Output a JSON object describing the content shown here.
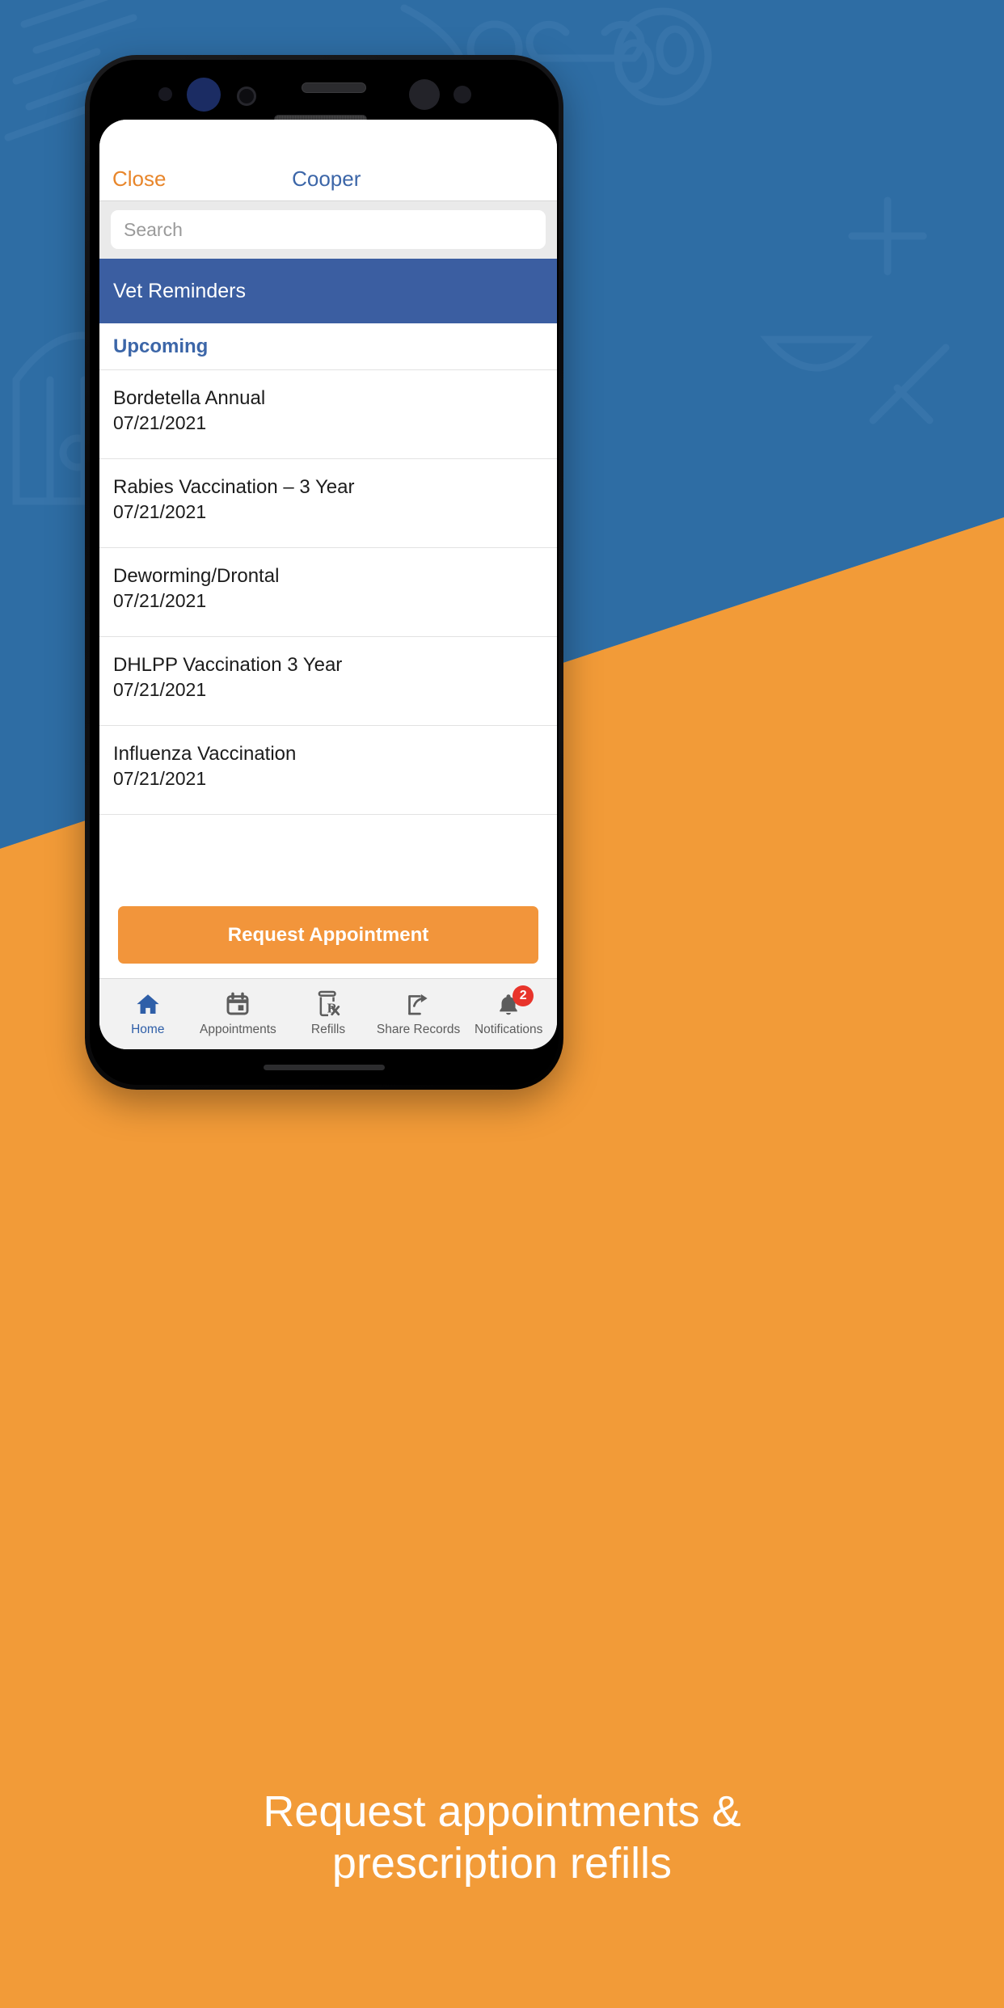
{
  "phone": {
    "app": {
      "nav": {
        "close_label": "Close",
        "title": "Cooper"
      },
      "search": {
        "placeholder": "Search",
        "value": ""
      },
      "section": {
        "title": "Vet Reminders"
      },
      "subsection": {
        "title": "Upcoming"
      },
      "reminders": [
        {
          "title": "Bordetella Annual",
          "date": "07/21/2021"
        },
        {
          "title": "Rabies Vaccination – 3 Year",
          "date": "07/21/2021"
        },
        {
          "title": "Deworming/Drontal",
          "date": "07/21/2021"
        },
        {
          "title": "DHLPP Vaccination 3 Year",
          "date": "07/21/2021"
        },
        {
          "title": "Influenza Vaccination",
          "date": "07/21/2021"
        }
      ],
      "cta": {
        "label": "Request Appointment"
      },
      "tabs": [
        {
          "label": "Home",
          "icon": "home-icon",
          "active": true,
          "badge": ""
        },
        {
          "label": "Appointments",
          "icon": "calendar-icon",
          "active": false,
          "badge": ""
        },
        {
          "label": "Refills",
          "icon": "pill-bottle-rx-icon",
          "active": false,
          "badge": ""
        },
        {
          "label": "Share Records",
          "icon": "share-arrow-icon",
          "active": false,
          "badge": ""
        },
        {
          "label": "Notifications",
          "icon": "bell-icon",
          "active": false,
          "badge": "2"
        }
      ]
    }
  },
  "caption": {
    "line1": "Request appointments &",
    "line2": "prescription refills"
  },
  "colors": {
    "brand_orange": "#F2953B",
    "brand_blue": "#3B5EA1",
    "link_blue": "#3C66A8",
    "close_orange": "#E8862B",
    "badge_red": "#E8342B",
    "bg_blue": "#2E6DA4",
    "bg_orange": "#F29B38"
  }
}
